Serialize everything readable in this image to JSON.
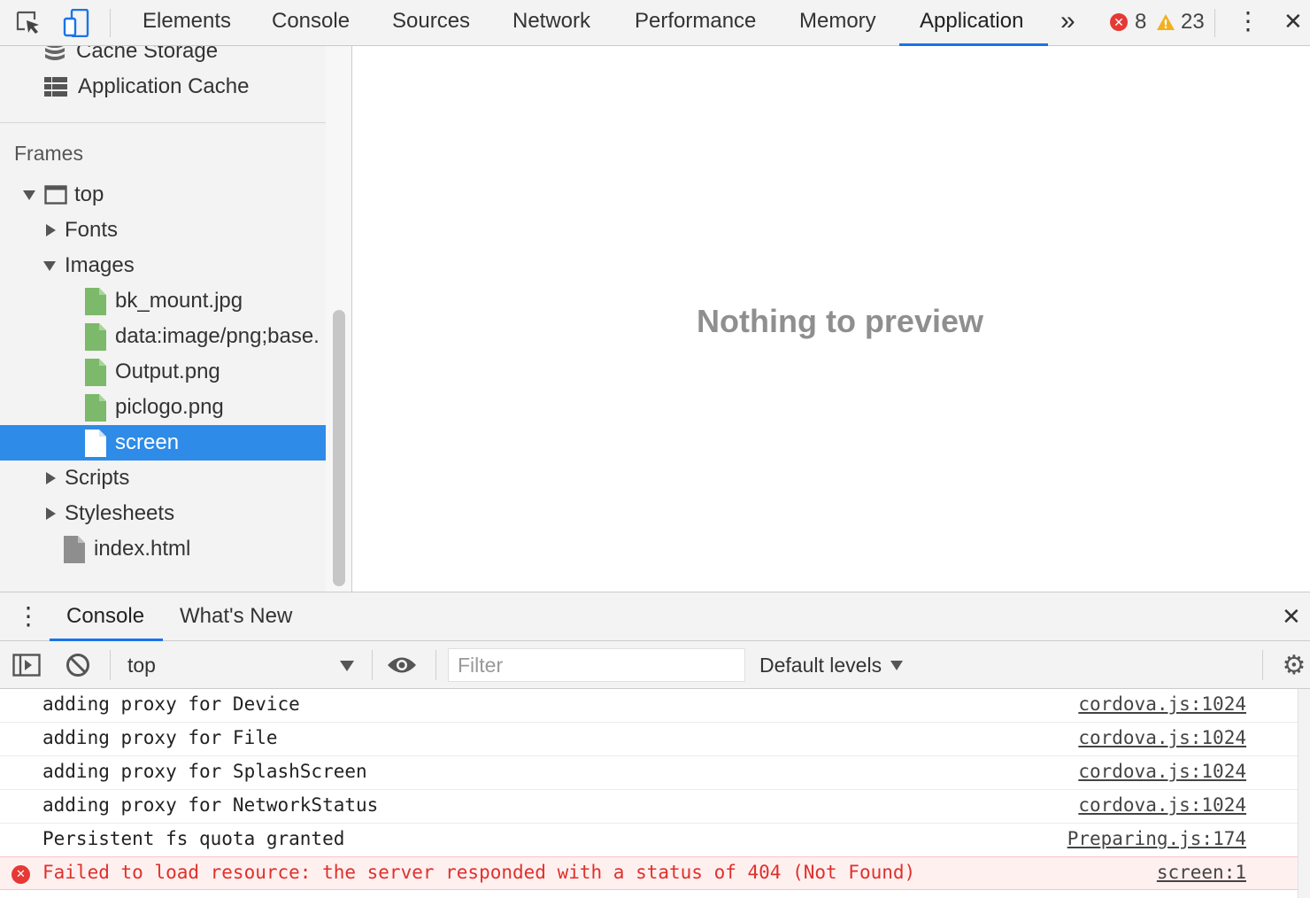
{
  "toolbar": {
    "tabs": [
      "Elements",
      "Console",
      "Sources",
      "Network",
      "Performance",
      "Memory",
      "Application"
    ],
    "active_tab": "Application",
    "more_tabs_glyph": "»",
    "error_count": "8",
    "warning_count": "23",
    "error_glyph": "✕",
    "warning_glyph": "!",
    "menu_glyph": "⋮",
    "close_glyph": "✕"
  },
  "sidebar": {
    "storage_items": [
      {
        "label": "Cache Storage",
        "icon": "database-icon"
      },
      {
        "label": "Application Cache",
        "icon": "grid-icon"
      }
    ],
    "frames_header": "Frames",
    "frame_top": "top",
    "tree": [
      {
        "label": "Fonts",
        "expanded": false
      },
      {
        "label": "Images",
        "expanded": true
      },
      {
        "label": "bk_mount.jpg",
        "type": "image"
      },
      {
        "label": "data:image/png;base.",
        "type": "image"
      },
      {
        "label": "Output.png",
        "type": "image"
      },
      {
        "label": "piclogo.png",
        "type": "image"
      },
      {
        "label": "screen",
        "type": "document",
        "selected": true
      },
      {
        "label": "Scripts",
        "expanded": false
      },
      {
        "label": "Stylesheets",
        "expanded": false
      },
      {
        "label": "index.html",
        "type": "html"
      }
    ]
  },
  "preview": {
    "empty_text": "Nothing to preview"
  },
  "drawer": {
    "tabs": [
      "Console",
      "What's New"
    ],
    "active_tab": "Console",
    "menu_glyph": "⋮",
    "close_glyph": "✕"
  },
  "console_bar": {
    "context": "top",
    "filter_placeholder": "Filter",
    "levels": "Default levels",
    "gear_glyph": "⚙"
  },
  "messages": [
    {
      "text": "adding proxy for Device",
      "source": "cordova.js:1024",
      "level": "log"
    },
    {
      "text": "adding proxy for File",
      "source": "cordova.js:1024",
      "level": "log"
    },
    {
      "text": "adding proxy for SplashScreen",
      "source": "cordova.js:1024",
      "level": "log"
    },
    {
      "text": "adding proxy for NetworkStatus",
      "source": "cordova.js:1024",
      "level": "log"
    },
    {
      "text": "Persistent fs quota granted",
      "source": "Preparing.js:174",
      "level": "log"
    },
    {
      "text": "Failed to load resource: the server responded with a status of 404 (Not Found)",
      "source": "screen:1",
      "level": "error",
      "icon_glyph": "✕"
    }
  ],
  "colors": {
    "accent": "#1a73e8",
    "selection": "#2e8be8",
    "error": "#e53935",
    "warning": "#f2b01e",
    "image_file": "#7cb96a"
  }
}
